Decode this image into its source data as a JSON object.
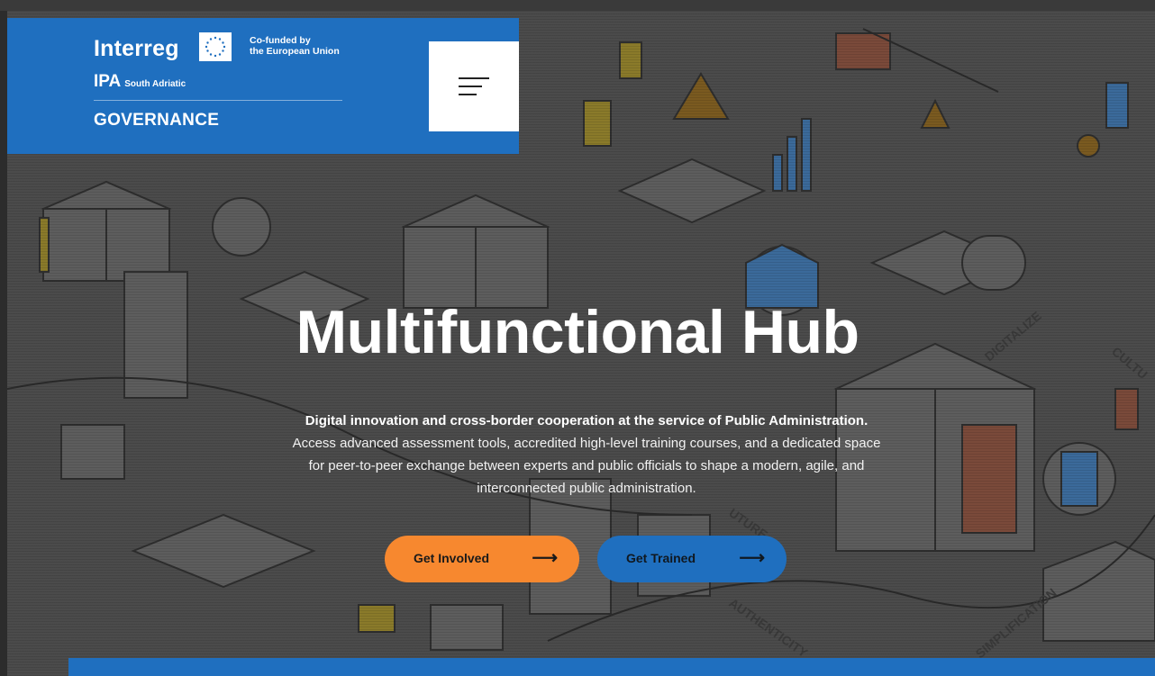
{
  "colors": {
    "brand_blue": "#1f6fbf",
    "accent_orange": "#f7882f",
    "panel_white": "#ffffff"
  },
  "header": {
    "logo_interreg": "Interreg",
    "cofunded_line1": "Co-funded by",
    "cofunded_line2": "the European Union",
    "ipa": "IPA",
    "ipa_sub": "South Adriatic",
    "governance": "GOVERNANCE",
    "menu_icon": "hamburger-menu-icon"
  },
  "hero": {
    "title": "Multifunctional Hub",
    "lead": "Digital innovation and cross-border cooperation at the service of Public Administration.",
    "description": "Access advanced assessment tools, accredited high-level training courses, and a dedicated space for peer-to-peer exchange between experts and public officials to shape a modern, agile, and interconnected public administration.",
    "background_words": [
      "DIGITALIZE",
      "CULTU",
      "UTURE",
      "AUTHENTICITY",
      "SIMPLIFICATION"
    ]
  },
  "actions": {
    "get_involved": "Get Involved",
    "get_trained": "Get Trained",
    "arrow_icon": "arrow-right-icon",
    "arrow_glyph": "⟶"
  }
}
